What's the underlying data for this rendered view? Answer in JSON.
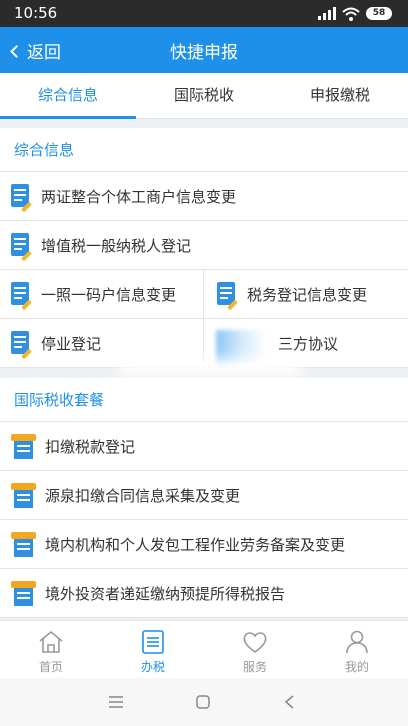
{
  "status_bar": {
    "time": "10:56",
    "battery": "58"
  },
  "app_bar": {
    "back_label": "返回",
    "title": "快捷申报"
  },
  "tabs": [
    {
      "label": "综合信息",
      "active": true
    },
    {
      "label": "国际税收",
      "active": false
    },
    {
      "label": "申报缴税",
      "active": false
    }
  ],
  "sections": [
    {
      "title": "综合信息",
      "items": [
        "两证整合个体工商户信息变更",
        "增值税一般纳税人登记",
        "一照一码户信息变更",
        "税务登记信息变更",
        "停业登记",
        "三方协议"
      ]
    },
    {
      "title": "国际税收套餐",
      "items": [
        "扣缴税款登记",
        "源泉扣缴合同信息采集及变更",
        "境内机构和个人发包工程作业劳务备案及变更",
        "境外投资者递延缴纳预提所得税报告"
      ]
    }
  ],
  "bottom_nav": [
    {
      "label": "首页",
      "icon": "home-icon",
      "active": false
    },
    {
      "label": "办税",
      "icon": "tax-list-icon",
      "active": true
    },
    {
      "label": "服务",
      "icon": "heart-icon",
      "active": false
    },
    {
      "label": "我的",
      "icon": "person-icon",
      "active": false
    }
  ],
  "colors": {
    "accent": "#1e90ea",
    "status_bar": "#2b2b2b",
    "icon_orange": "#f2a81e"
  }
}
